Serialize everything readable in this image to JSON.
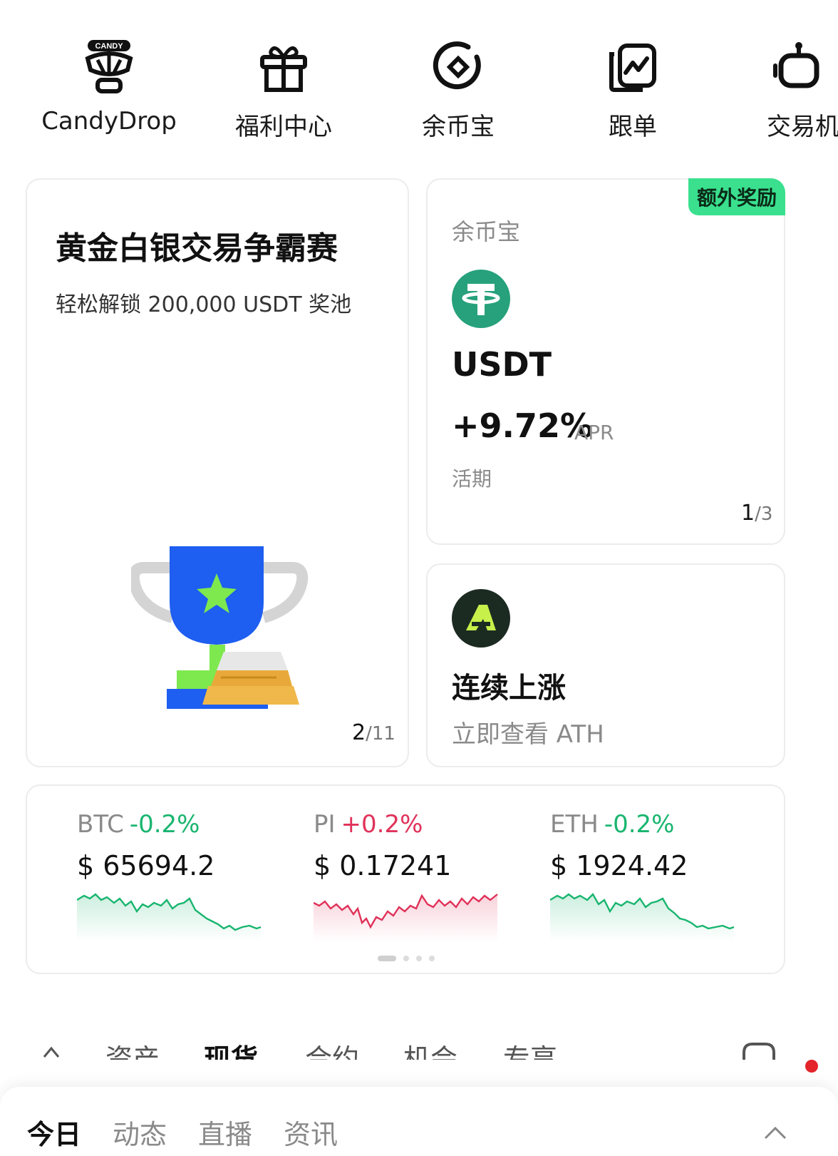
{
  "shortcuts": [
    {
      "label": "CandyDrop",
      "icon": "candy-drop-icon",
      "icon_text": "CANDY"
    },
    {
      "label": "福利中心",
      "icon": "gift-icon"
    },
    {
      "label": "余币宝",
      "icon": "earn-icon"
    },
    {
      "label": "跟单",
      "icon": "copy-trade-icon"
    },
    {
      "label": "交易机",
      "icon": "trading-bot-icon"
    }
  ],
  "promo": {
    "title": "黄金白银交易争霸赛",
    "subtitle": "轻松解锁 200,000 USDT 奖池",
    "page_current": "2",
    "page_total": "/11"
  },
  "earn": {
    "label": "余币宝",
    "badge": "额外奖励",
    "coin": "USDT",
    "apr": "+9.72%",
    "apr_unit": "APR",
    "term": "活期",
    "page_current": "1",
    "page_total": "/3"
  },
  "trend": {
    "title": "连续上涨",
    "subtitle": "立即查看 ATH"
  },
  "tickers": [
    {
      "name": "BTC",
      "change": "-0.2%",
      "price": "$ 65694.2",
      "direction": "down"
    },
    {
      "name": "PI",
      "change": "+0.2%",
      "price": "$ 0.17241",
      "direction": "up"
    },
    {
      "name": "ETH",
      "change": "-0.2%",
      "price": "$ 1924.42",
      "direction": "down"
    }
  ],
  "ghost_tabs": [
    "资产",
    "现货",
    "合约",
    "机会",
    "专享"
  ],
  "sheet_tabs": [
    {
      "label": "今日",
      "active": true
    },
    {
      "label": "动态",
      "active": false
    },
    {
      "label": "直播",
      "active": false
    },
    {
      "label": "资讯",
      "active": false
    }
  ],
  "colors": {
    "positive": "#e0325a",
    "negative": "#19b56f",
    "badge": "#3ae08e",
    "usdt": "#26a17b"
  }
}
